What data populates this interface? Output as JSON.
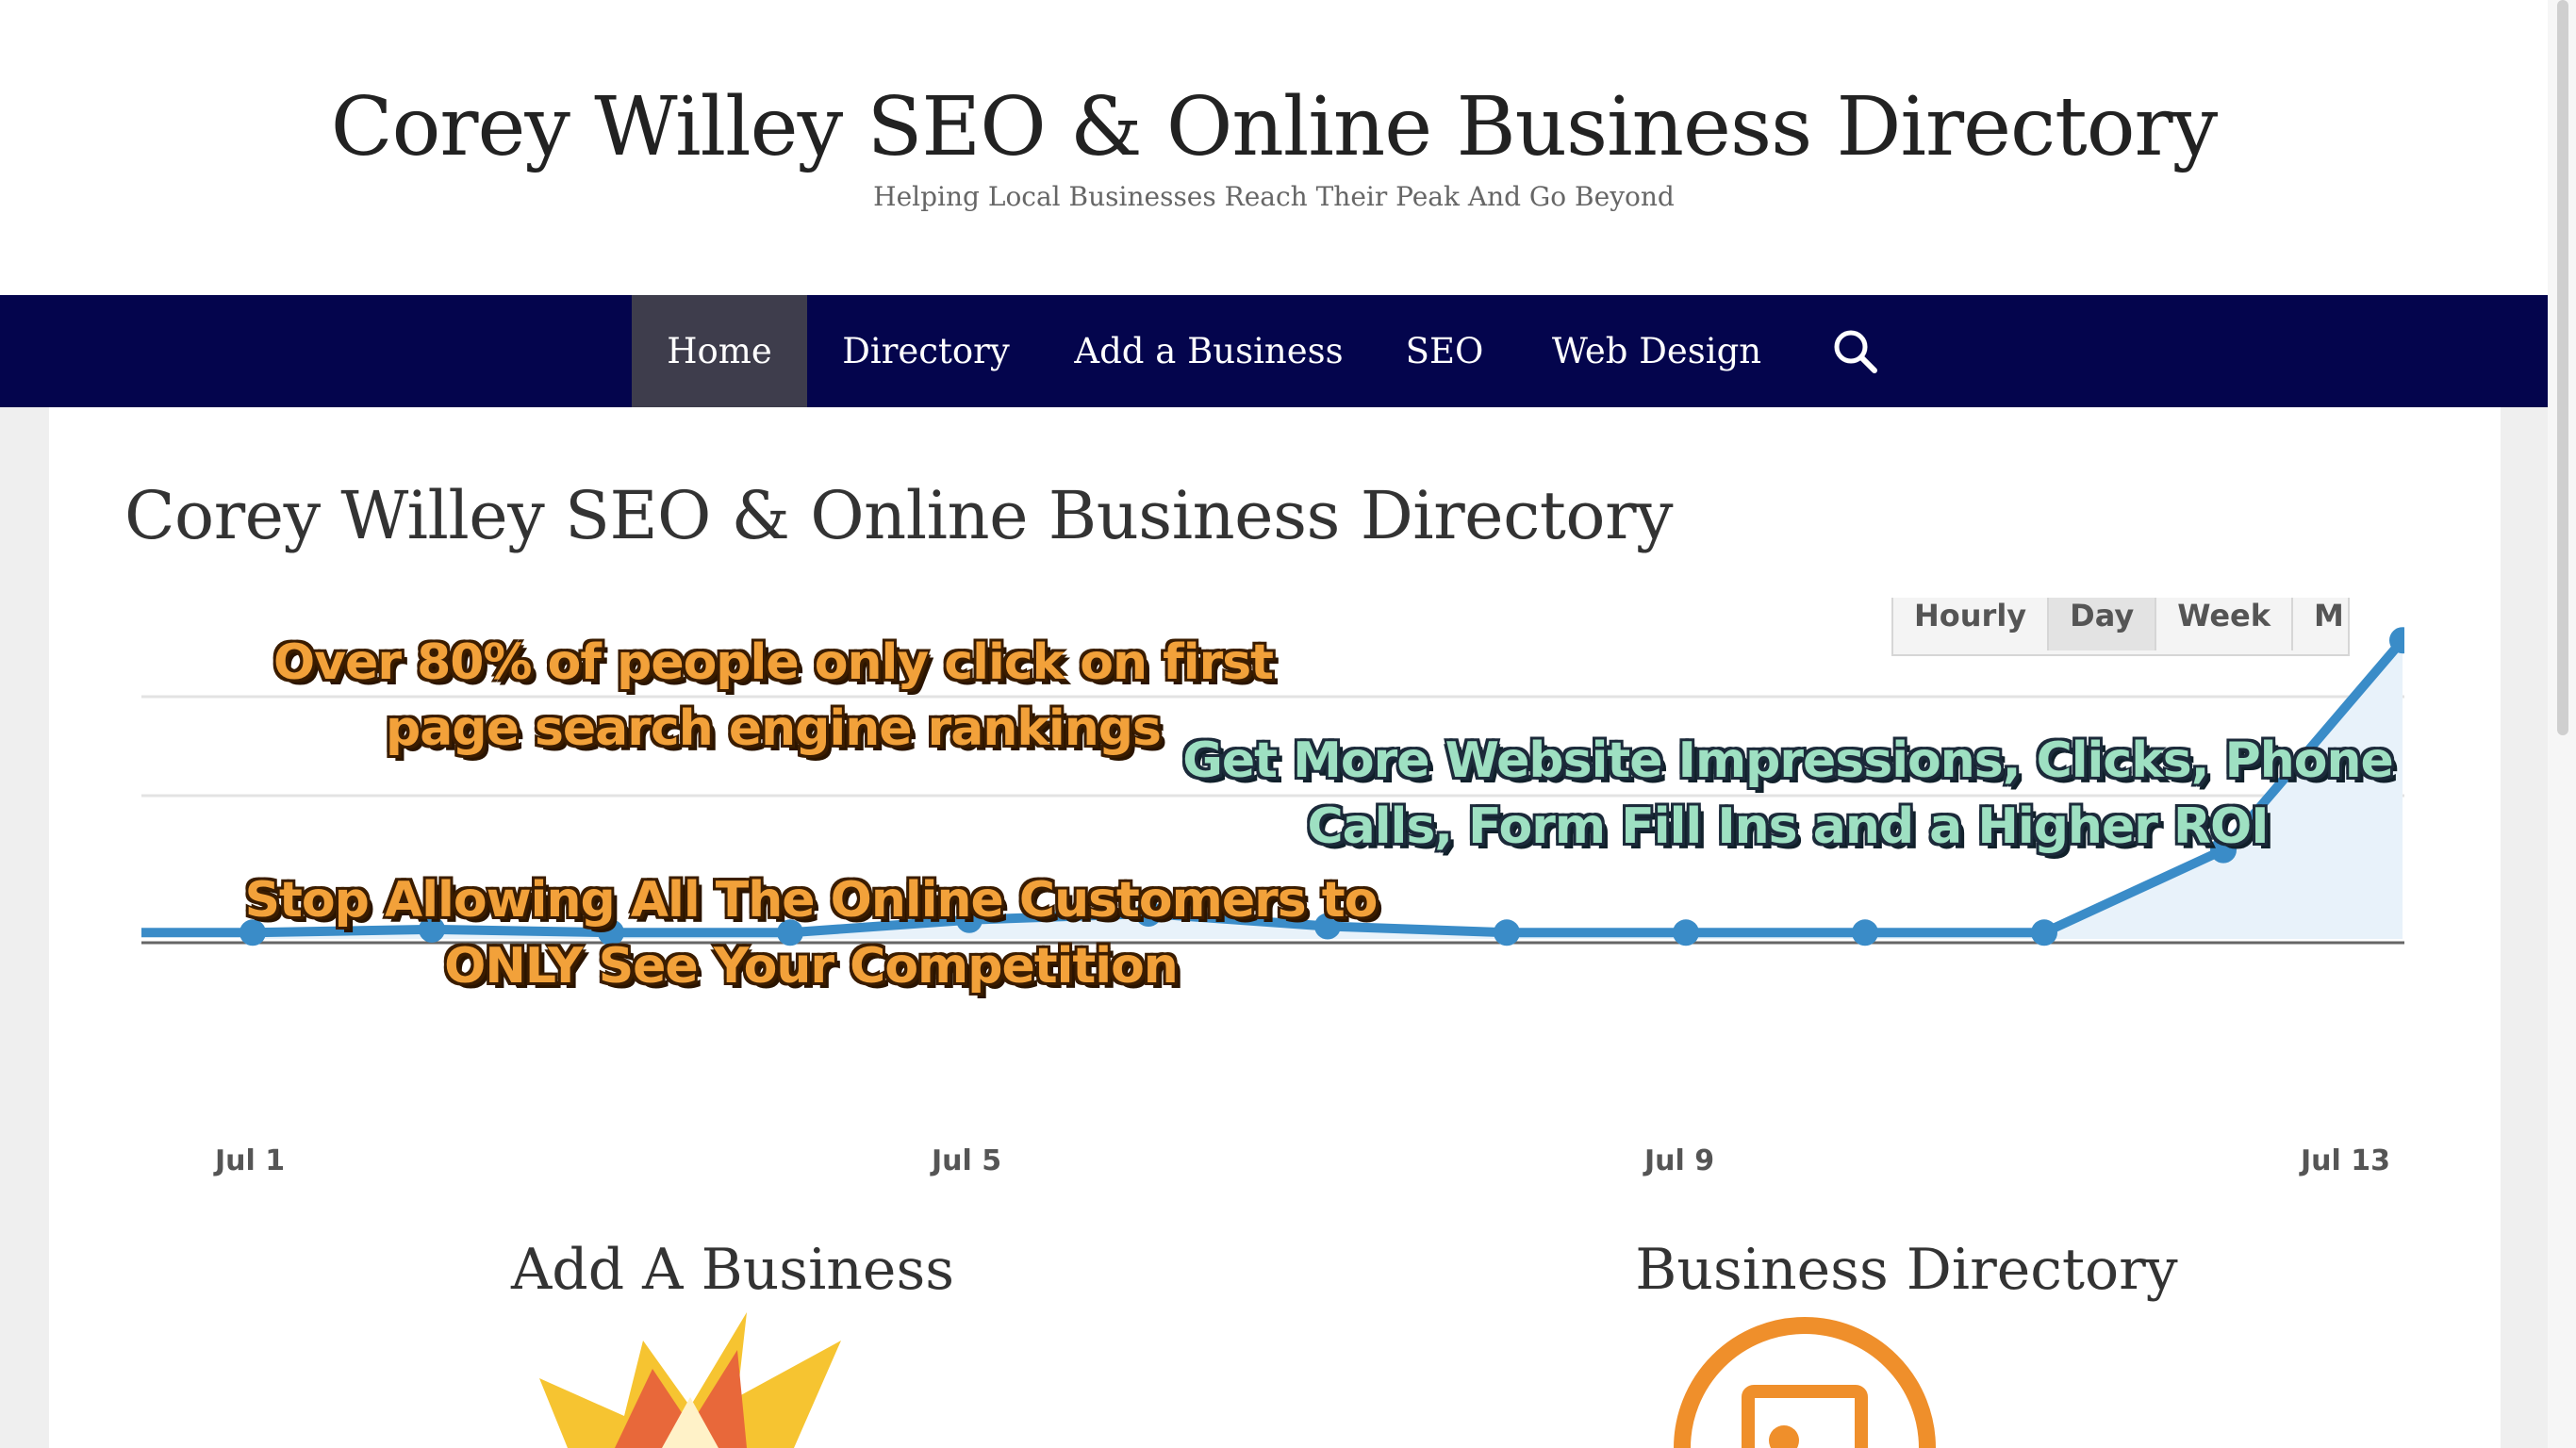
{
  "header": {
    "title": "Corey Willey SEO & Online Business Directory",
    "tagline": "Helping Local Businesses Reach Their Peak And Go Beyond"
  },
  "nav": {
    "items": [
      {
        "label": "Home",
        "active": true
      },
      {
        "label": "Directory",
        "active": false
      },
      {
        "label": "Add a Business",
        "active": false
      },
      {
        "label": "SEO",
        "active": false
      },
      {
        "label": "Web Design",
        "active": false
      }
    ],
    "search_icon": "search-icon"
  },
  "main": {
    "page_title": "Corey Willey SEO & Online Business Directory",
    "banner": {
      "tabs": [
        "Hourly",
        "Day",
        "Week",
        "M"
      ],
      "selected_tab": "Day",
      "promo_1_line1": "Over 80% of people only click on first",
      "promo_1_line2": "page search engine rankings",
      "promo_2_line1": "Get More Website Impressions, Clicks, Phone",
      "promo_2_line2": "Calls, Form Fill Ins and a Higher ROI",
      "promo_3_line1": "Stop Allowing All The Online Customers to",
      "promo_3_line2": "ONLY See Your Competition"
    },
    "section_add": "Add A Business",
    "section_directory": "Business Directory"
  },
  "chart_data": {
    "type": "area",
    "x": [
      "Jul 1",
      "Jul 2",
      "Jul 3",
      "Jul 4",
      "Jul 5",
      "Jul 6",
      "Jul 7",
      "Jul 8",
      "Jul 9",
      "Jul 10",
      "Jul 11",
      "Jul 12",
      "Jul 13"
    ],
    "tick_labels": [
      "Jul 1",
      "Jul 5",
      "Jul 9",
      "Jul 13"
    ],
    "series": [
      {
        "values": [
          1,
          1.5,
          1,
          1,
          3,
          4,
          2,
          1,
          1,
          1,
          1,
          14,
          47
        ]
      }
    ],
    "ylim": [
      0,
      50
    ],
    "grid": true,
    "color": "#3a8cc8",
    "fill": "#e8f2fa"
  }
}
